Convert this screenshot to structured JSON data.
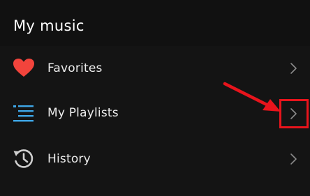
{
  "header": {
    "title": "My music"
  },
  "menu": {
    "items": [
      {
        "label": "Favorites",
        "icon": "heart-icon",
        "chevron": "chevron-right-icon"
      },
      {
        "label": "My Playlists",
        "icon": "playlist-icon",
        "chevron": "chevron-right-icon"
      },
      {
        "label": "History",
        "icon": "history-icon",
        "chevron": "chevron-right-icon"
      }
    ]
  },
  "annotation": {
    "arrow": "red-arrow-icon",
    "highlight_color": "#e8141c"
  },
  "colors": {
    "background": "#141414",
    "heart": "#f2443c",
    "playlist_icon": "#3ea6e6",
    "history_icon": "#cfcfcf",
    "chevron": "#8a8a8a"
  }
}
